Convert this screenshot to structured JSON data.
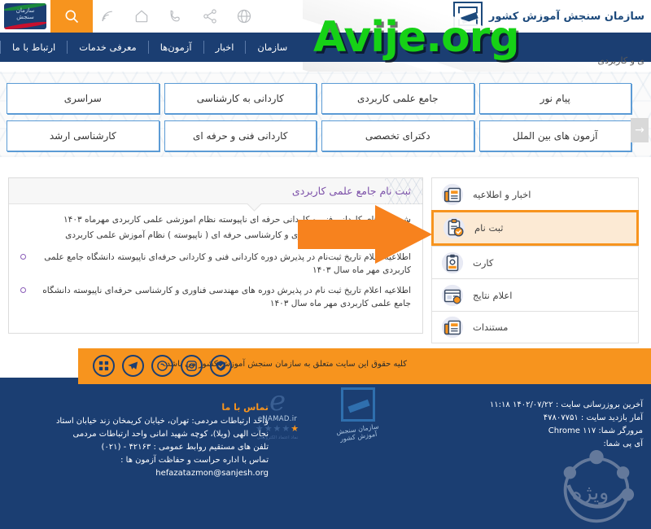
{
  "header": {
    "org_title": "سازمان سنجش آموزش کشور",
    "logo_alt": "سازمان سنجش",
    "watermark": "Avije.org",
    "breadcrumb": "ی و کاربردی",
    "search_icon": "search-icon",
    "utility_icons": [
      "globe-icon",
      "share-icon",
      "phone-icon",
      "home-icon",
      "rss-icon"
    ]
  },
  "nav": {
    "items": [
      {
        "label": "سازمان"
      },
      {
        "label": "اخبار"
      },
      {
        "label": "آزمون‌ها"
      },
      {
        "label": "معرفی خدمات"
      },
      {
        "label": "ارتباط با ما"
      }
    ]
  },
  "categories": {
    "buttons": [
      {
        "label": "پیام نور"
      },
      {
        "label": "جامع علمی کاربردی"
      },
      {
        "label": "کاردانی به کارشناسی"
      },
      {
        "label": "سراسری"
      },
      {
        "label": "آزمون های بین الملل"
      },
      {
        "label": "دکترای تخصصی"
      },
      {
        "label": "کاردانی فنی و حرفه ای"
      },
      {
        "label": "کارشناسی ارشد"
      }
    ],
    "next_arrow": "→"
  },
  "panel": {
    "title": "ثبت نام جامع علمی کاربردی",
    "lines": [
      "ش دوره های کاردانی فنی و کاردانی حرفه ای ناپیوسته نظام اموزشی علمی کاربردی مهرماه ۱۴۰۳",
      "پذیرش دوره های مهندسی فناوری و کارشناسی حرفه ای ( ناپیوسته ) نظام آموزش علمی کاربردی"
    ],
    "news": [
      "اطلاعیه اعلام تاریخ ثبت‌نام در پذیرش دوره کاردانی فنی و کاردانی حرفه‌ای ناپیوسته دانشگاه جامع علمی کاربردی مهر ماه سال ۱۴۰۳",
      "اطلاعیه اعلام تاریخ ثبت نام در پذیرش دوره های مهندسی فناوری و کارشناسی حرفه‌ای ناپیوسته دانشگاه جامع علمی کاربردی مهر ماه سال ۱۴۰۳"
    ]
  },
  "sidemenu": {
    "items": [
      {
        "label": "اخبار و اطلاعیه",
        "icon": "news-icon",
        "active": false
      },
      {
        "label": "ثبت نام",
        "icon": "clipboard-check-icon",
        "active": true
      },
      {
        "label": "کارت",
        "icon": "id-card-icon",
        "active": false
      },
      {
        "label": "اعلام نتایج",
        "icon": "results-icon",
        "active": false
      },
      {
        "label": "مستندات",
        "icon": "documents-icon",
        "active": false
      }
    ]
  },
  "footer": {
    "copyright": "کلیه حقوق این سایت متعلق به سازمان سنجش آموزش کشور می باشد.",
    "social_icons": [
      "check-shield-icon",
      "instagram-icon",
      "aparat-icon",
      "telegram-icon",
      "apps-icon"
    ],
    "contact": {
      "title": "تماس با ما",
      "lines": [
        "واحد ارتباطات مردمی: تهران، خیابان کریمخان زند خیابان استاد",
        "نجات الهی (ویلا)، کوچه شهید امانی واحد ارتباطات مردمی",
        "تلفن های مستقیم روابط عمومی : ۴۲۱۶۳ - (۰۲۱)",
        "تماس با اداره حراست و حفاظت آزمون ها :"
      ],
      "email": "hefazatazmon@sanjesh.org"
    },
    "stats": [
      {
        "label": "آخرین بروزرسانی سایت :",
        "value": "۱۴۰۲/۰۷/۲۲ ۱۱:۱۸"
      },
      {
        "label": "آمار بازدید سایت :",
        "value": "۴۷۸۰۷۷۵۱"
      },
      {
        "label": "مرورگر شما:",
        "value": "Chrome ۱۱۷"
      },
      {
        "label": "آی پی شما:",
        "value": ""
      }
    ],
    "badges": {
      "sanjesh_caption": "سازمان سنجش آموزش کشور",
      "enamad_letter": "e",
      "enamad_name": "eNAMAD.ir",
      "enamad_stars": "★★★★★",
      "enamad_sub": "نماد اعتماد الکترونیکی",
      "vije_watermark": "ویژه"
    }
  },
  "colors": {
    "navy": "#1b3e72",
    "orange": "#f7941e",
    "panel_title": "#7b4fa8",
    "button_border": "#5b9bd5",
    "watermark_green": "#16d116"
  }
}
